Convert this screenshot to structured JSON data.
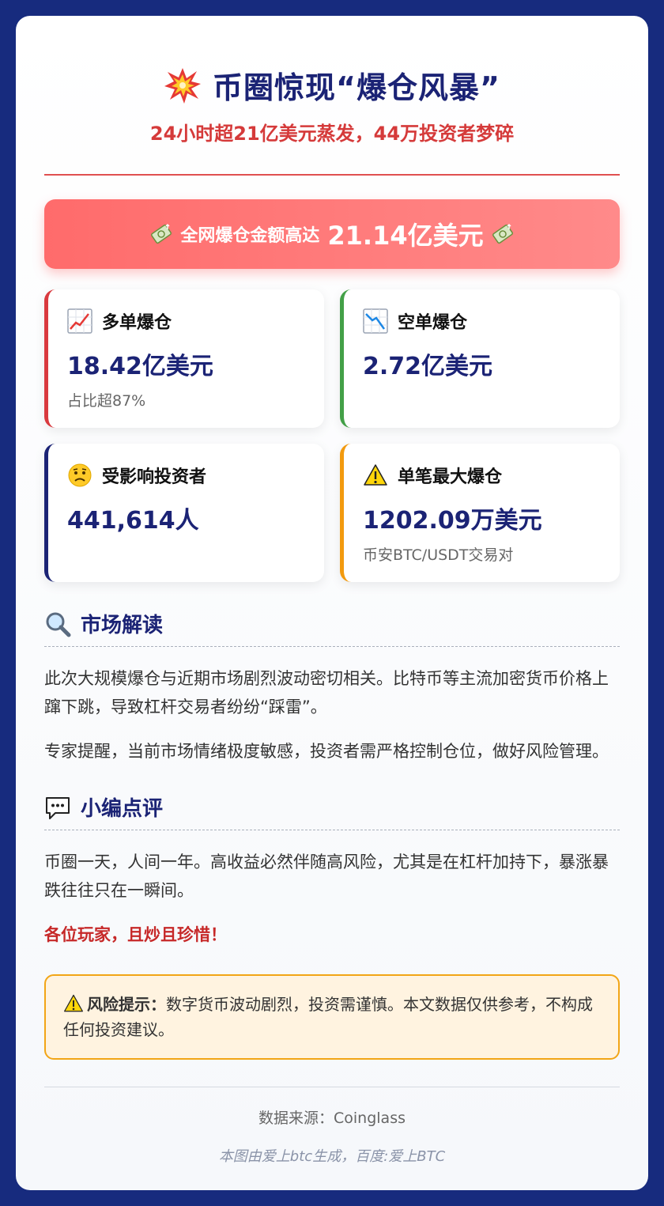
{
  "header": {
    "title": "币圈惊现“爆仓风暴”",
    "title_icon": "collision-icon",
    "subtitle": "24小时超21亿美元蒸发，44万投资者梦碎"
  },
  "banner": {
    "label": "全网爆仓金额高达",
    "value": "21.14亿美元",
    "icon": "money-icon",
    "color": "#ff6b6b"
  },
  "stats": [
    {
      "label": "多单爆仓",
      "value": "18.42亿美元",
      "note": "占比超87%",
      "icon": "chart-up-icon",
      "accent": "#d9393e"
    },
    {
      "label": "空单爆仓",
      "value": "2.72亿美元",
      "note": "",
      "icon": "chart-down-icon",
      "accent": "#43a047"
    },
    {
      "label": "受影响投资者",
      "value": "441,614人",
      "note": "",
      "icon": "worried-face-icon",
      "accent": "#1b2375"
    },
    {
      "label": "单笔最大爆仓",
      "value": "1202.09万美元",
      "note": "币安BTC/USDT交易对",
      "icon": "warning-icon",
      "accent": "#f29a0e"
    }
  ],
  "analysis": {
    "title": "市场解读",
    "icon": "magnifier-icon",
    "paragraphs": [
      "此次大规模爆仓与近期市场剧烈波动密切相关。比特币等主流加密货币价格上蹿下跳，导致杠杆交易者纷纷“踩雷”。",
      "专家提醒，当前市场情绪极度敏感，投资者需严格控制仓位，做好风险管理。"
    ]
  },
  "comment": {
    "title": "小编点评",
    "icon": "speech-bubble-icon",
    "paragraph": "币圈一天，人间一年。高收益必然伴随高风险，尤其是在杠杆加持下，暴涨暴跌往往只在一瞬间。",
    "highlight": "各位玩家，且炒且珍惜！"
  },
  "risk": {
    "label": "风险提示：",
    "text": "数字货币波动剧烈，投资需谨慎。本文数据仅供参考，不构成任何投资建议。",
    "border_color": "#f2a516"
  },
  "footer": {
    "source": "数据来源：Coinglass",
    "credit": "本图由爱上btc生成，百度:爱上BTC"
  }
}
